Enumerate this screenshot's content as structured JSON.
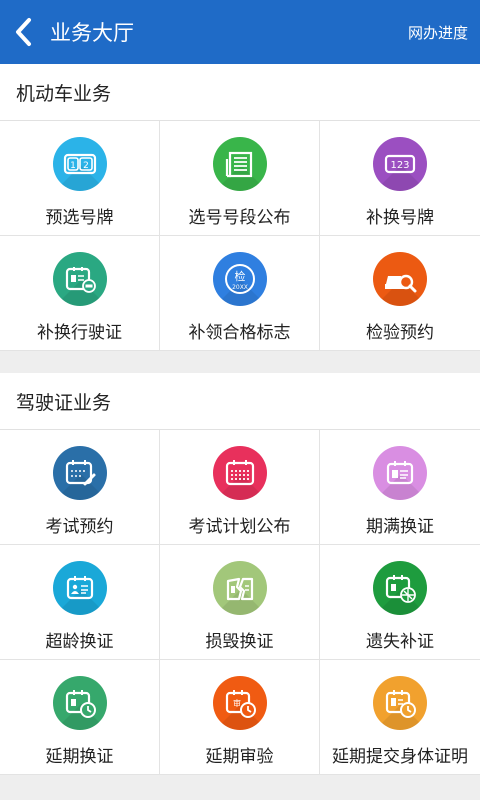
{
  "header": {
    "title": "业务大厅",
    "progress_label": "网办进度"
  },
  "sections": [
    {
      "title": "机动车业务",
      "items": [
        {
          "label": "预选号牌",
          "icon": "number-plate-icon",
          "color": "#2bb3e8"
        },
        {
          "label": "选号号段公布",
          "icon": "newspaper-icon",
          "color": "#39b54a"
        },
        {
          "label": "补换号牌",
          "icon": "plate-123-icon",
          "color": "#9b4fc1"
        },
        {
          "label": "补换行驶证",
          "icon": "vehicle-license-icon",
          "color": "#2aa882"
        },
        {
          "label": "补领合格标志",
          "icon": "inspection-sticker-icon",
          "color": "#2f7fe0"
        },
        {
          "label": "检验预约",
          "icon": "car-search-icon",
          "color": "#ec5a12"
        }
      ]
    },
    {
      "title": "驾驶证业务",
      "items": [
        {
          "label": "考试预约",
          "icon": "calendar-edit-icon",
          "color": "#2a6fa8"
        },
        {
          "label": "考试计划公布",
          "icon": "calendar-icon",
          "color": "#e8305c"
        },
        {
          "label": "期满换证",
          "icon": "id-card-icon",
          "color": "#d98ee2"
        },
        {
          "label": "超龄换证",
          "icon": "id-card-age-icon",
          "color": "#1aa8d8"
        },
        {
          "label": "损毁换证",
          "icon": "damaged-card-icon",
          "color": "#a2c77a"
        },
        {
          "label": "遗失补证",
          "icon": "lost-card-icon",
          "color": "#1e9c3e"
        },
        {
          "label": "延期换证",
          "icon": "card-clock-icon",
          "color": "#36a86c"
        },
        {
          "label": "延期审验",
          "icon": "audit-clock-icon",
          "color": "#f05b12"
        },
        {
          "label": "延期提交身体证明",
          "icon": "medical-clock-icon",
          "color": "#f1a12e"
        }
      ]
    }
  ]
}
